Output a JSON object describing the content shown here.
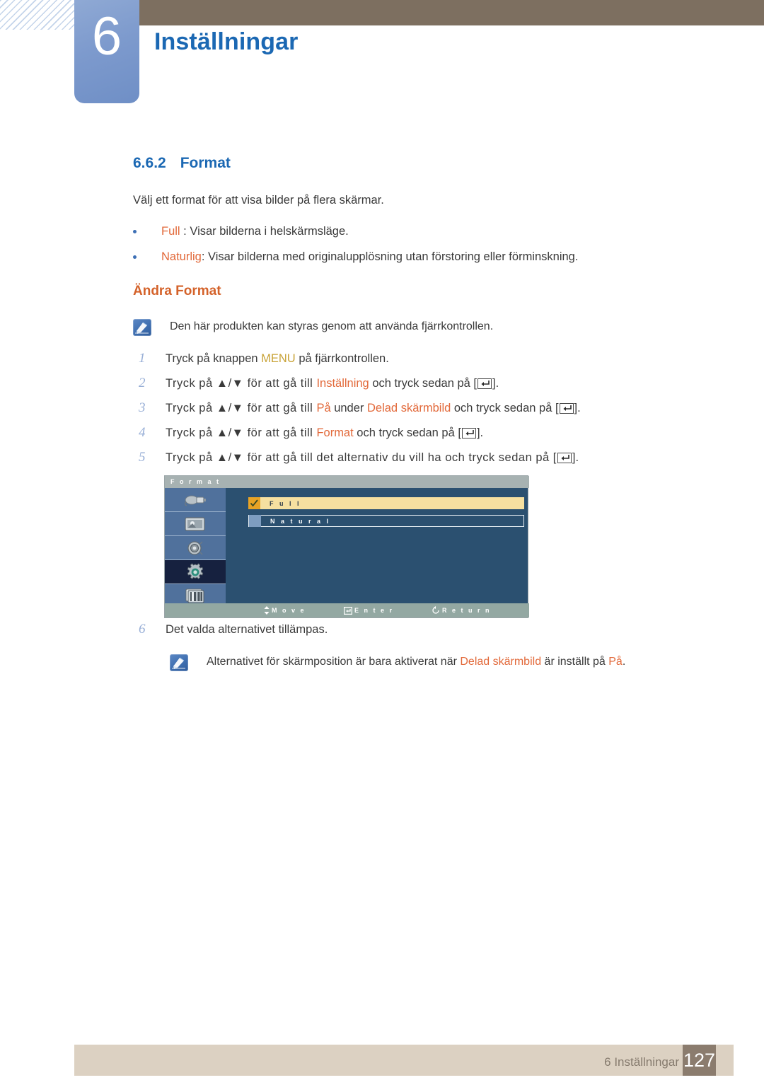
{
  "header": {
    "chapter_number": "6",
    "chapter_title": "Inställningar"
  },
  "section": {
    "number": "6.6.2",
    "title": "Format",
    "intro": "Välj ett format för att visa bilder på flera skärmar.",
    "bullets": [
      {
        "term": "Full",
        "sep": " : ",
        "desc": "Visar bilderna i helskärmsläge."
      },
      {
        "term": "Naturlig",
        "sep": ": ",
        "desc": "Visar bilderna med originalupplösning utan förstoring eller förminskning."
      }
    ],
    "subheading": "Ändra Format"
  },
  "notes": {
    "note_top": "Den här produkten kan styras genom att använda fjärrkontrollen.",
    "note_bottom_pre": "Alternativet för skärmposition är bara aktiverat när ",
    "note_bottom_hl1": "Delad skärmbild",
    "note_bottom_mid": " är inställt på ",
    "note_bottom_hl2": "På",
    "note_bottom_end": "."
  },
  "steps": [
    {
      "num": "1",
      "pre": "Tryck på knappen ",
      "hl": "MENU",
      "post": " på fjärrkontrollen.",
      "end": ""
    },
    {
      "num": "2",
      "pre": "Tryck på ▲/▼ för att gå till ",
      "hl": "Inställning",
      "post": " och tryck sedan på [",
      "end": "]."
    },
    {
      "num": "3",
      "pre": "Tryck på ▲/▼ för att gå till ",
      "hl": "På",
      "mid": " under ",
      "hl2": "Delad skärmbild",
      "post": " och tryck sedan på [",
      "end": "]."
    },
    {
      "num": "4",
      "pre": "Tryck på ▲/▼ för att gå till ",
      "hl": "Format",
      "post": " och tryck sedan på [",
      "end": "]."
    },
    {
      "num": "5",
      "pre": "Tryck på ▲/▼ för att gå till det alternativ du vill ha och tryck sedan på [",
      "hl": "",
      "post": "",
      "end": "]."
    },
    {
      "num": "6",
      "pre": "Det valda alternativet tillämpas.",
      "hl": "",
      "post": "",
      "end": ""
    }
  ],
  "osd": {
    "title": "F o r m a t",
    "sidebar_icons": [
      "input-source-icon",
      "picture-icon",
      "sound-speaker-icon",
      "setup-gear-icon",
      "multi-display-icon"
    ],
    "selected_icon_index": 3,
    "options": [
      {
        "label": "F u l l",
        "checked": true
      },
      {
        "label": "N a t u r a l",
        "checked": false
      }
    ],
    "hints": {
      "move": "M o v e",
      "enter": "E n t e r",
      "return": "R e t u r n"
    },
    "colors": {
      "panel_bg": "#2b5070",
      "sidebar_bg": "#50719c",
      "highlight": "#f6e0a0",
      "checkbox_on": "#e8a325",
      "title_bar": "#a7b2b2",
      "bottom_bar": "#93a8a2"
    }
  },
  "footer": {
    "label": "6 Inställningar",
    "page_number": "127"
  },
  "theme": {
    "heading_blue": "#1b68b3",
    "accent_orange": "#e2693a",
    "accent_gold": "#c8a236",
    "header_brown": "#7d6f60",
    "footer_beige": "#dcd1c2",
    "page_box_brown": "#8b7c6e"
  }
}
